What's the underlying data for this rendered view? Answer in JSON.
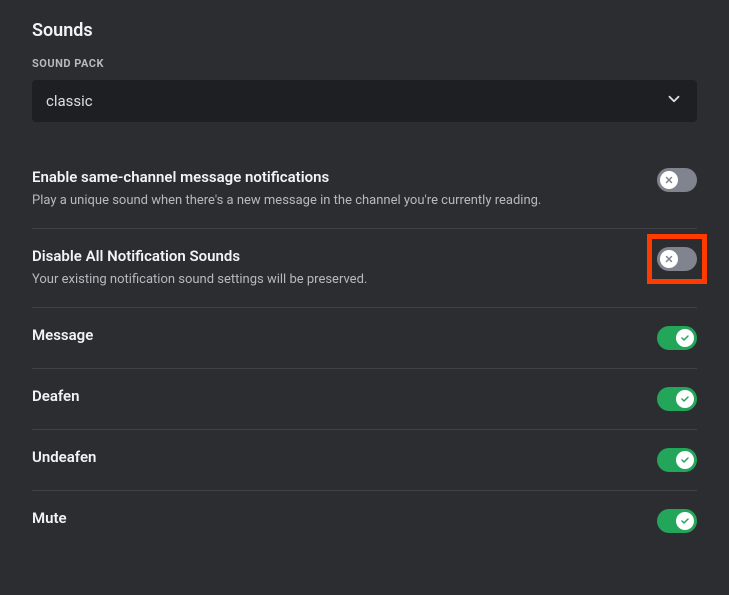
{
  "section": {
    "title": "Sounds",
    "packLabel": "SOUND PACK"
  },
  "soundPack": {
    "value": "classic"
  },
  "settings": {
    "sameChannel": {
      "title": "Enable same-channel message notifications",
      "desc": "Play a unique sound when there's a new message in the channel you're currently reading.",
      "on": false
    },
    "disableAll": {
      "title": "Disable All Notification Sounds",
      "desc": "Your existing notification sound settings will be preserved.",
      "on": false,
      "highlighted": true
    },
    "items": [
      {
        "title": "Message",
        "on": true
      },
      {
        "title": "Deafen",
        "on": true
      },
      {
        "title": "Undeafen",
        "on": true
      },
      {
        "title": "Mute",
        "on": true
      }
    ]
  }
}
